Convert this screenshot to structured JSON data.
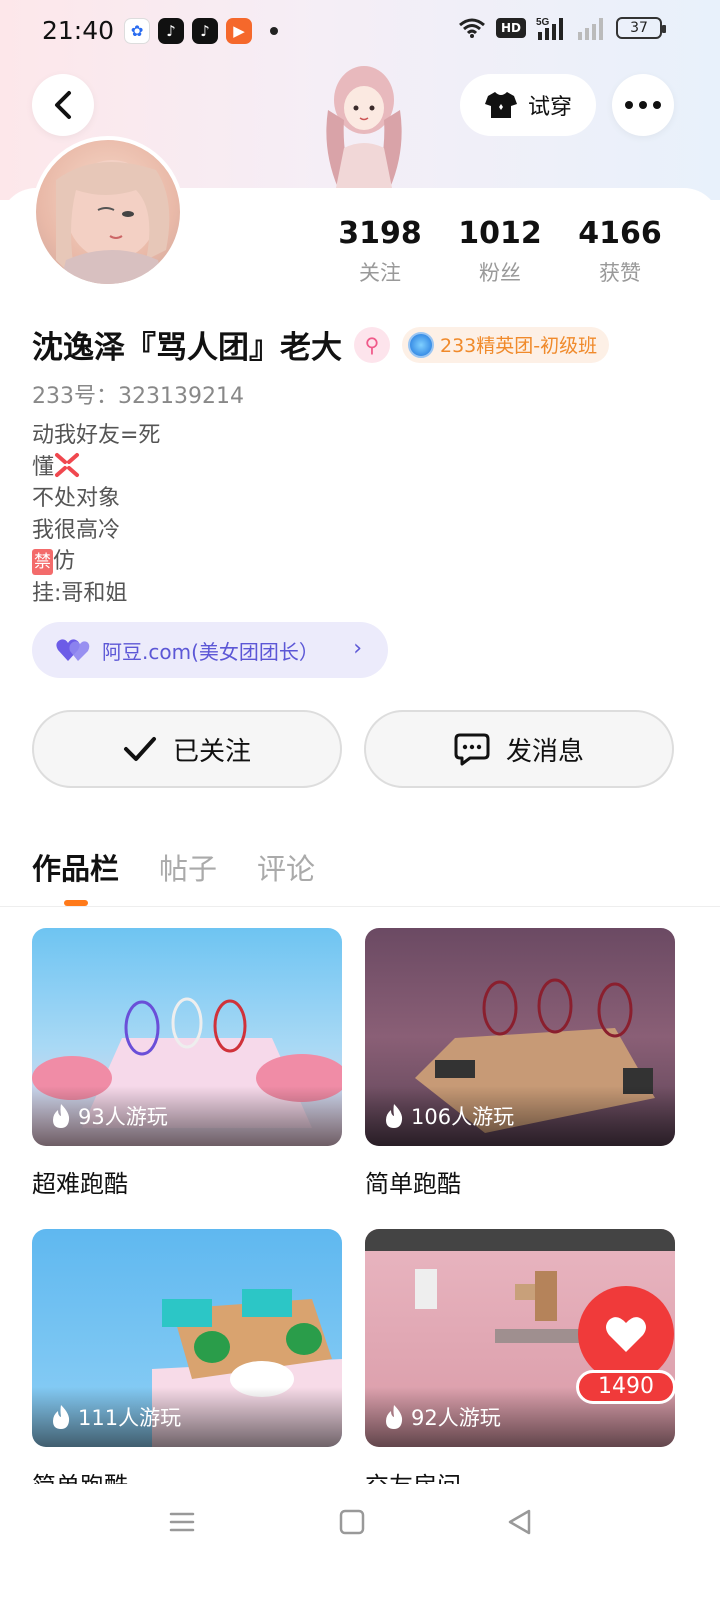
{
  "status_bar": {
    "time": "21:40",
    "battery": "37",
    "network": "5G",
    "hd": "HD"
  },
  "header": {
    "try_on_label": "试穿"
  },
  "profile": {
    "name": "沈逸泽『骂人团』老大",
    "badge": "233精英团-初级班",
    "uid": "233号：323139214",
    "bio": [
      "动我好友=死",
      "懂",
      "不处对象",
      "我很高冷",
      "仿",
      "挂:哥和姐"
    ],
    "bio_ban_char": "禁",
    "family": "阿豆.com(美女团团长）"
  },
  "stats": [
    {
      "value": "3198",
      "label": "关注"
    },
    {
      "value": "1012",
      "label": "粉丝"
    },
    {
      "value": "4166",
      "label": "获赞"
    }
  ],
  "actions": {
    "follow": "已关注",
    "message": "发消息"
  },
  "tabs": [
    "作品栏",
    "帖子",
    "评论"
  ],
  "works": [
    {
      "title": "超难跑酷",
      "plays": "93人游玩"
    },
    {
      "title": "简单跑酷",
      "plays": "106人游玩"
    },
    {
      "title": "简单跑酷",
      "plays": "111人游玩"
    },
    {
      "title": "交友房间",
      "plays": "92人游玩"
    }
  ],
  "like": {
    "count": "1490"
  },
  "colors": {
    "accent": "#ff7a1a",
    "like": "#f03a3a",
    "family": "#5c57d6",
    "badge": "#f08a2b"
  },
  "icons": [
    "back-icon",
    "tshirt-icon",
    "more-icon",
    "check-icon",
    "chat-icon",
    "heart-icon",
    "flame-icon",
    "menu-icon",
    "home-icon",
    "back-triangle-icon"
  ]
}
